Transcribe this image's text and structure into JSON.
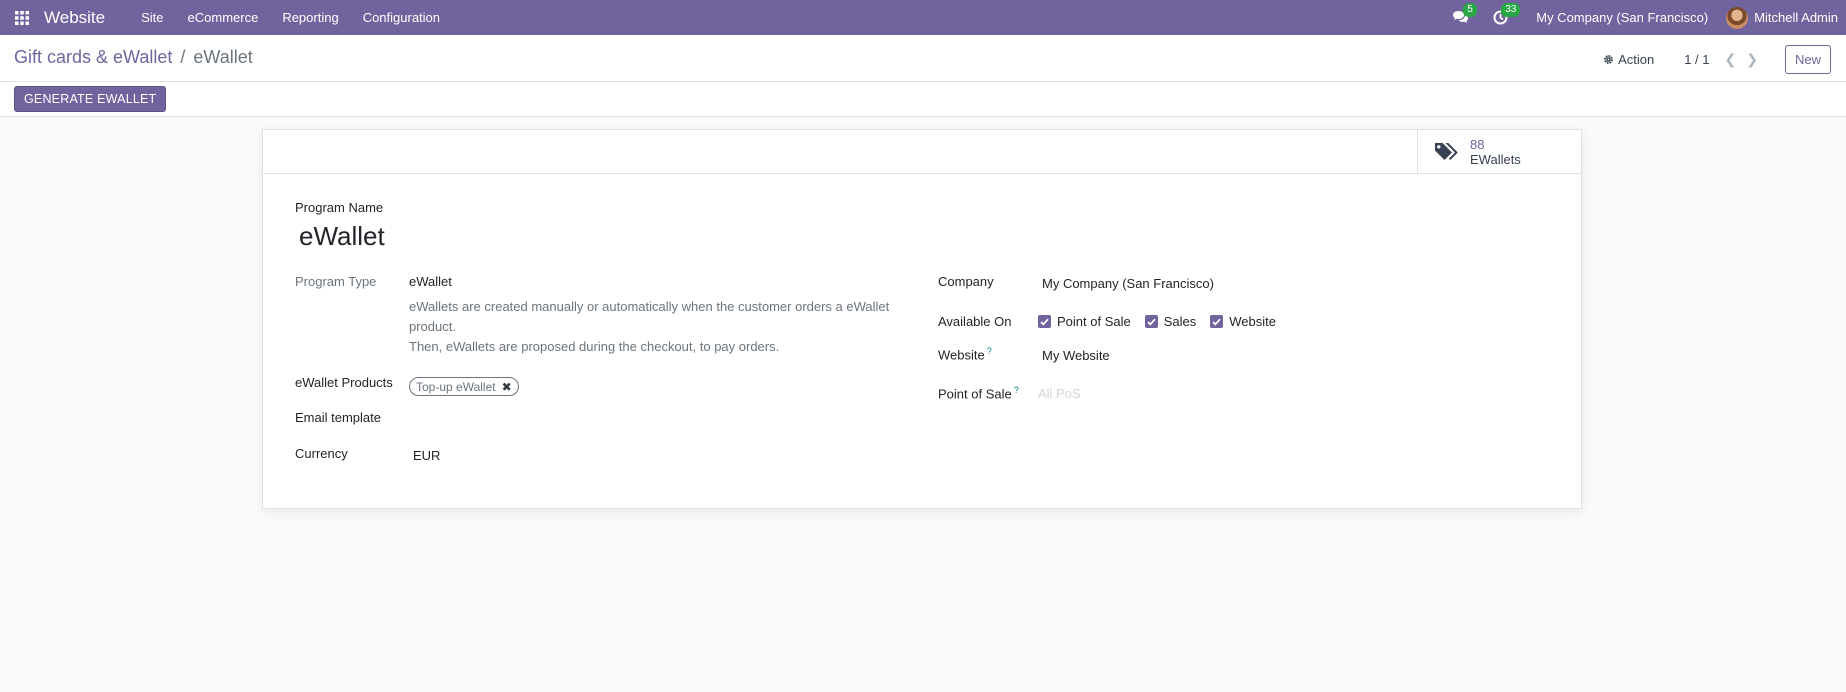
{
  "navbar": {
    "brand": "Website",
    "menus": [
      "Site",
      "eCommerce",
      "Reporting",
      "Configuration"
    ],
    "messages_count": "5",
    "activities_count": "33",
    "company": "My Company (San Francisco)",
    "user": "Mitchell Admin"
  },
  "control_panel": {
    "breadcrumb_parent": "Gift cards & eWallet",
    "breadcrumb_separator": "/",
    "breadcrumb_current": "eWallet",
    "action_label": "Action",
    "pager": "1 / 1",
    "new_label": "New",
    "generate_label": "GENERATE EWALLET"
  },
  "form": {
    "stat_button": {
      "value": "88",
      "label": "EWallets"
    },
    "program_name_label": "Program Name",
    "program_name": "eWallet",
    "program_type_label": "Program Type",
    "program_type": "eWallet",
    "program_help_1": "eWallets are created manually or automatically when the customer orders a eWallet product.",
    "program_help_2": "Then, eWallets are proposed during the checkout, to pay orders.",
    "products_label": "eWallet Products",
    "product_tag": "Top-up eWallet",
    "email_template_label": "Email template",
    "currency_label": "Currency",
    "currency": "EUR",
    "company_label": "Company",
    "company": "My Company (San Francisco)",
    "available_on_label": "Available On",
    "available_on": [
      "Point of Sale",
      "Sales",
      "Website"
    ],
    "website_label": "Website",
    "website": "My Website",
    "pos_label": "Point of Sale",
    "pos_placeholder": "All PoS",
    "help_mark": "?"
  },
  "colors": {
    "brand": "#71639e",
    "badge": "#28a745",
    "help": "#017e84"
  }
}
